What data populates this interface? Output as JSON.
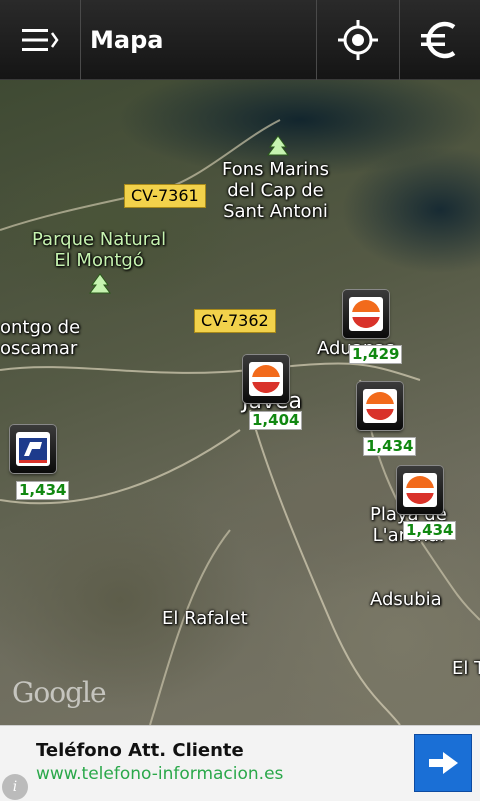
{
  "app": {
    "title": "Mapa"
  },
  "colors": {
    "accent": "#1a6fd6",
    "price_text": "#118811",
    "road_badge": "#f2d24b"
  },
  "icons": {
    "menu": "menu-icon",
    "locate": "crosshair-icon",
    "currency": "euro-icon"
  },
  "map": {
    "labels": {
      "fons_l1": "Fons Marins",
      "fons_l2": "del Cap de",
      "fons_l3": "Sant Antoni",
      "parque_l1": "Parque Natural",
      "parque_l2": "El Montgó",
      "montgo_l1": "ontgo de",
      "montgo_l2": "oscamar",
      "aduanas": "Aduanas",
      "javea": "Jávea",
      "playa_l1": "Playa de",
      "playa_l2": "L'arenal",
      "rafalet": "El Rafalet",
      "adsubia": "Adsubia",
      "el_t": "El T"
    },
    "roads": {
      "cv7361": "CV-7361",
      "cv7362": "CV-7362"
    },
    "prices": [
      "1,429",
      "1,404",
      "1,434",
      "1,434",
      "1,434"
    ],
    "attribution": "Google"
  },
  "ad": {
    "title": "Teléfono Att. Cliente",
    "url": "www.telefono-informacion.es",
    "info": "i"
  }
}
